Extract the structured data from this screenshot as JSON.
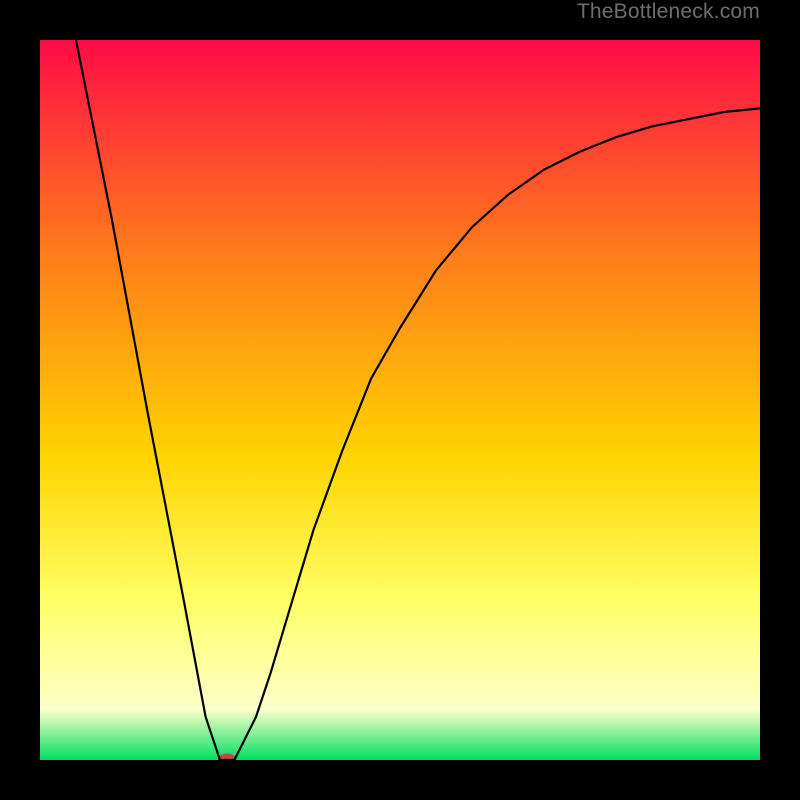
{
  "watermark": "TheBottleneck.com",
  "chart_data": {
    "type": "line",
    "title": "",
    "xlabel": "",
    "ylabel": "",
    "xlim": [
      0,
      100
    ],
    "ylim": [
      0,
      100
    ],
    "grid": false,
    "legend": false,
    "series": [
      {
        "name": "curve",
        "color": "#000000",
        "x": [
          5,
          10,
          15,
          20,
          23,
          25,
          27,
          30,
          32,
          35,
          38,
          42,
          46,
          50,
          55,
          60,
          65,
          70,
          75,
          80,
          85,
          90,
          95,
          100
        ],
        "y": [
          100,
          75,
          48,
          22,
          6,
          0,
          0,
          6,
          12,
          22,
          32,
          43,
          53,
          60,
          68,
          74,
          78.5,
          82,
          84.5,
          86.5,
          88,
          89,
          90,
          90.5
        ]
      }
    ],
    "marker": {
      "name": "target-dot",
      "color": "#c24a40",
      "x": 26,
      "y": 0,
      "rx": 1.3,
      "ry": 0.9
    },
    "background_gradient": {
      "top": "#ff0b46",
      "upper_mid": "#ff7d1a",
      "mid": "#ffd400",
      "lower_mid": "#ffff66",
      "pale_band": "#fcffc9",
      "bottom": "#00e060"
    }
  }
}
